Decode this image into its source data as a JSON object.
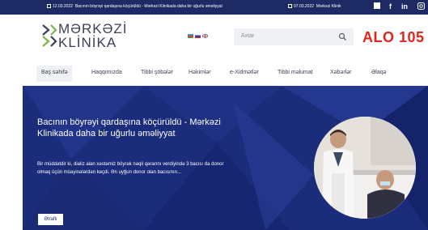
{
  "topbar": {
    "news1_date": "12.03.2022",
    "news1_text": "Bacının böyrəyi qardaşına köçürüldü - Mərkəzi Klinikada daha bir uğurlu əməliyyat",
    "news2_date": "07.03.2022",
    "news2_text": "Mərkəzi Klinik",
    "social": [
      "square-icon",
      "facebook-icon",
      "linkedin-icon",
      "instagram-icon"
    ]
  },
  "header": {
    "logo_line1": "MƏRKƏZİ",
    "logo_line2": "KLİNİKA",
    "flags": [
      "az-flag-icon",
      "ru-flag-icon",
      "gb-flag-icon"
    ],
    "search_placeholder": "Axtar",
    "hotline": "ALO 105",
    "brand_color": "#e1251b"
  },
  "nav": {
    "items": [
      "Baş səhifə",
      "Haqqımızda",
      "Tibbi şöbələr",
      "Həkimlər",
      "e-Xidmətlər",
      "Tibbi məlumat",
      "Xəbərlər",
      "Əlaqə"
    ],
    "active": "Baş səhifə"
  },
  "hero": {
    "title": "Bacının böyrəyi qardaşına köçürüldü - Mərkəzi Klinikada daha bir uğurlu əməliyyat",
    "description": "Bir müddətdir ki, dializ alan xəstəmiz böyrək nəqli qərarını verdiyində 3 bacısı da donor olmaq üçün müayinələrdən keçdi. Ən uyğun donor olan bacısının...",
    "button": "Ətraflı",
    "background_color": "#1b2c7a"
  }
}
